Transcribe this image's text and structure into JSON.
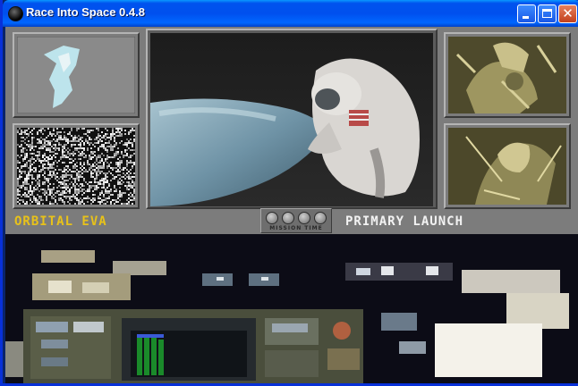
{
  "window": {
    "title": "Race Into Space 0.4.8"
  },
  "mission": {
    "name": "ORBITAL EVA",
    "phase": "PRIMARY LAUNCH",
    "timer_label": "MISSION TIME"
  },
  "colors": {
    "mission_name": "#e8c21a",
    "phase_text": "#f2f2f2",
    "panel_gray": "#7c7c7c"
  },
  "icons": [
    "app-icon",
    "minimize-icon",
    "maximize-icon",
    "close-icon",
    "mission-time-dial-icon"
  ]
}
